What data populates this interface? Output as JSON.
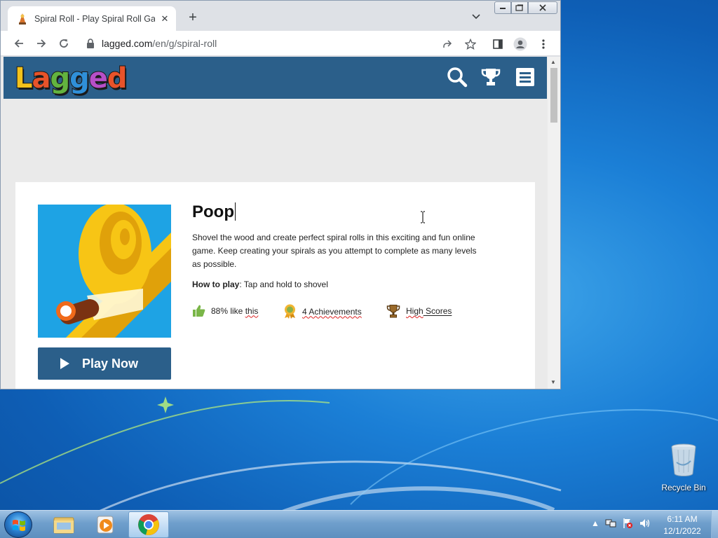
{
  "browser": {
    "tab_title": "Spiral Roll - Play Spiral Roll Game",
    "url_host": "lagged.com",
    "url_path": "/en/g/spiral-roll"
  },
  "site": {
    "logo_letters": [
      "L",
      "a",
      "g",
      "g",
      "e",
      "d"
    ],
    "logo_colors": [
      "#f4c21b",
      "#e8532a",
      "#62b33f",
      "#2f8fd8",
      "#b64fc8",
      "#e8532a"
    ]
  },
  "game": {
    "title": "Poop",
    "description": "Shovel the wood and create perfect spiral rolls in this exciting and fun online game. Keep creating your spirals as you attempt to complete as many levels as possible.",
    "how_to_play_label": "How to play",
    "how_to_play_sep": ": ",
    "how_to_play_text": "Tap and hold to shovel",
    "play_button": "Play Now",
    "likes_prefix": "88% like ",
    "likes_link": "this",
    "achievements": "4 Achievements",
    "high_scores_word1": "High",
    "high_scores_word2": " Scores"
  },
  "desktop": {
    "recycle_bin": "Recycle Bin"
  },
  "taskbar": {
    "time": "6:11 AM",
    "date": "12/1/2022"
  }
}
